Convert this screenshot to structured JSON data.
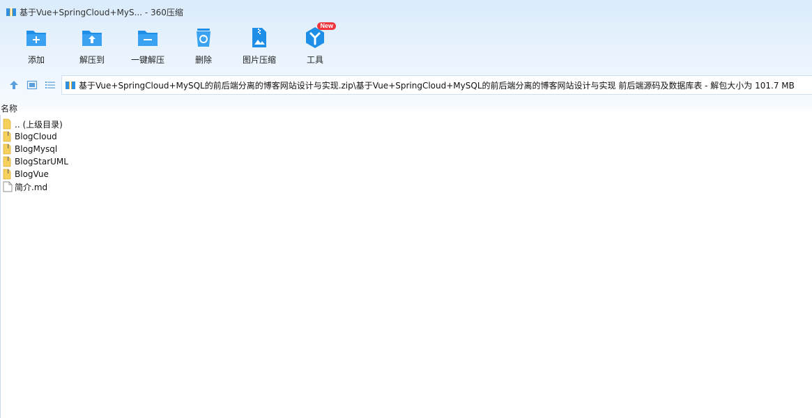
{
  "window": {
    "title": "基于Vue+SpringCloud+MyS... - 360压缩",
    "app_icon": "archive-icon"
  },
  "toolbar": {
    "items": [
      {
        "label": "添加",
        "icon": "folder-add-icon"
      },
      {
        "label": "解压到",
        "icon": "folder-extract-icon"
      },
      {
        "label": "一键解压",
        "icon": "folder-minus-icon"
      },
      {
        "label": "删除",
        "icon": "trash-icon"
      },
      {
        "label": "图片压缩",
        "icon": "image-compress-icon"
      },
      {
        "label": "工具",
        "icon": "tools-icon",
        "badge": "New"
      }
    ]
  },
  "nav": {
    "up_icon": "arrow-up-icon",
    "view_icon": "thumbnail-view-icon",
    "list_icon": "list-view-icon",
    "path": "基于Vue+SpringCloud+MySQL的前后端分离的博客网站设计与实现.zip\\基于Vue+SpringCloud+MySQL的前后端分离的博客网站设计与实现 前后端源码及数据库表 - 解包大小为 101.7 MB"
  },
  "list": {
    "header_name": "名称",
    "rows": [
      {
        "name": ".. (上级目录)",
        "type": "folder"
      },
      {
        "name": "BlogCloud",
        "type": "folder"
      },
      {
        "name": "BlogMysql",
        "type": "folder"
      },
      {
        "name": "BlogStarUML",
        "type": "folder"
      },
      {
        "name": "BlogVue",
        "type": "folder"
      },
      {
        "name": "简介.md",
        "type": "file"
      }
    ]
  },
  "colors": {
    "accent": "#1f8ee6",
    "badge": "#f0353c",
    "folder": "#f5d15c"
  }
}
